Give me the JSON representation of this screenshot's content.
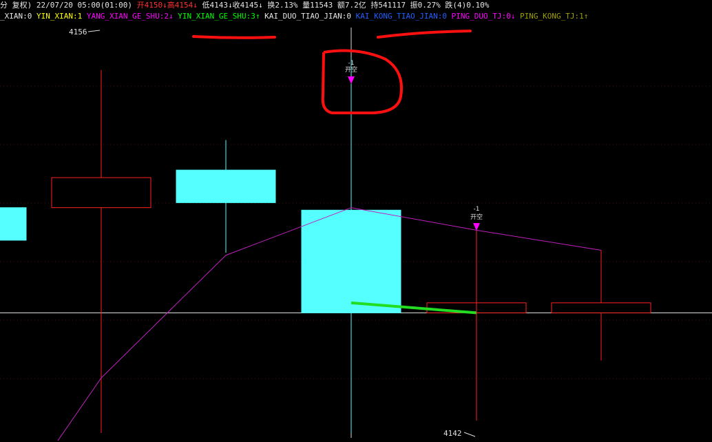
{
  "header": {
    "row1": [
      {
        "text": "分 复权) 22/07/20 05:00(01:00)",
        "color": "#e6e6e6"
      },
      {
        "text": " 开4150↓",
        "color": "#ff3030"
      },
      {
        "text": "高4154↓",
        "color": "#ff3030"
      },
      {
        "text": " 低4143↓",
        "color": "#e6e6e6"
      },
      {
        "text": "收4145↓",
        "color": "#e6e6e6"
      },
      {
        "text": " 换2.13%",
        "color": "#e6e6e6"
      },
      {
        "text": " 量11543",
        "color": "#e6e6e6"
      },
      {
        "text": " 额7.2亿",
        "color": "#e6e6e6"
      },
      {
        "text": " 持541117",
        "color": "#e6e6e6"
      },
      {
        "text": " 振0.27%",
        "color": "#e6e6e6"
      },
      {
        "text": " 跌(4)0.10%",
        "color": "#e6e6e6"
      }
    ],
    "row2": [
      {
        "text": "_XIAN:0 ",
        "color": "#e6e6e6"
      },
      {
        "text": "YIN_XIAN:1 ",
        "color": "#ffff00"
      },
      {
        "text": "YANG_XIAN_GE_SHU:2↓ ",
        "color": "#ff00ff"
      },
      {
        "text": "YIN_XIAN_GE_SHU:3↑ ",
        "color": "#00ff00"
      },
      {
        "text": "KAI_DUO_TIAO_JIAN:0 ",
        "color": "#e6e6e6"
      },
      {
        "text": "KAI_KONG_TIAO_JIAN:0 ",
        "color": "#2060ff"
      },
      {
        "text": "PING_DUO_TJ:0↓ ",
        "color": "#ff00ff"
      },
      {
        "text": "PING_KONG_TJ:1↑",
        "color": "#a0a000"
      }
    ]
  },
  "chart_data": {
    "type": "candlestick",
    "ylim": [
      4141.5,
      4157.5
    ],
    "high_label": "4156",
    "low_label": "4142",
    "candles": [
      {
        "open": 4150.5,
        "close": 4149.2,
        "high": 4150.5,
        "low": 4149.2,
        "color": "#55ffff",
        "partial": true
      },
      {
        "open": 4151.7,
        "close": 4150.5,
        "high": 4156,
        "low": 4141.5,
        "color": "#ff2020"
      },
      {
        "open": 4152,
        "close": 4150.7,
        "high": 4153.2,
        "low": 4148.7,
        "color": "#55ffff"
      },
      {
        "open": 4150.4,
        "close": 4146.3,
        "high": 4156.5,
        "low": 4141.5,
        "color": "#55ffff"
      },
      {
        "open": 4146.7,
        "close": 4146.3,
        "high": 4147.5,
        "low": 4142,
        "color": "#ff2020"
      },
      {
        "open": 4146.7,
        "close": 4146.3,
        "high": 4148.8,
        "low": 4144.4,
        "color": "#ff2020"
      }
    ],
    "ma_line": [
      4140.3,
      4143.7,
      4148.6,
      4150.5,
      4149.6,
      4148.8
    ],
    "green_segment": [
      4146.7,
      4146.3
    ],
    "signals": [
      {
        "candle": 3,
        "value": "-1",
        "text": "开空"
      },
      {
        "candle": 4,
        "value": "-1",
        "text": "开空"
      }
    ],
    "reference_level": 4146.3
  }
}
